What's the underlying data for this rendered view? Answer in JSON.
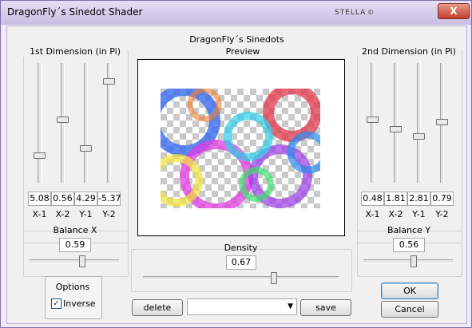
{
  "window": {
    "title": "DragonFly´s Sinedot Shader",
    "brand": "STELLA",
    "close_glyph": "X"
  },
  "header": {
    "group_title": "DragonFly´s Sinedots"
  },
  "dim1": {
    "title": "1st Dimension (in Pi)",
    "sliders": [
      {
        "value": "5.08",
        "label": "X-1",
        "level": 0.23
      },
      {
        "value": "0.56",
        "label": "X-2",
        "level": 0.53
      },
      {
        "value": "4.29",
        "label": "Y-1",
        "level": 0.29
      },
      {
        "value": "-5.37",
        "label": "Y-2",
        "level": 0.85
      }
    ]
  },
  "dim2": {
    "title": "2nd Dimension (in Pi)",
    "sliders": [
      {
        "value": "0.48",
        "label": "X-1",
        "level": 0.53
      },
      {
        "value": "1.81",
        "label": "X-2",
        "level": 0.45
      },
      {
        "value": "2.81",
        "label": "Y-1",
        "level": 0.39
      },
      {
        "value": "0.79",
        "label": "Y-2",
        "level": 0.51
      }
    ]
  },
  "preview": {
    "label": "Preview"
  },
  "balance_x": {
    "label": "Balance X",
    "value": "0.59",
    "level": 0.59
  },
  "balance_y": {
    "label": "Balance Y",
    "value": "0.56",
    "level": 0.56
  },
  "density": {
    "label": "Density",
    "value": "0.67",
    "level": 0.67
  },
  "options": {
    "label": "Options",
    "inverse_label": "Inverse",
    "inverse_checked": true
  },
  "presets": {
    "delete_label": "delete",
    "save_label": "save",
    "selected": ""
  },
  "buttons": {
    "ok_label": "OK",
    "cancel_label": "Cancel"
  },
  "colors": {
    "title_bar": "#c8bde2",
    "close_button": "#c2402c",
    "background": "#f0f0f0"
  }
}
